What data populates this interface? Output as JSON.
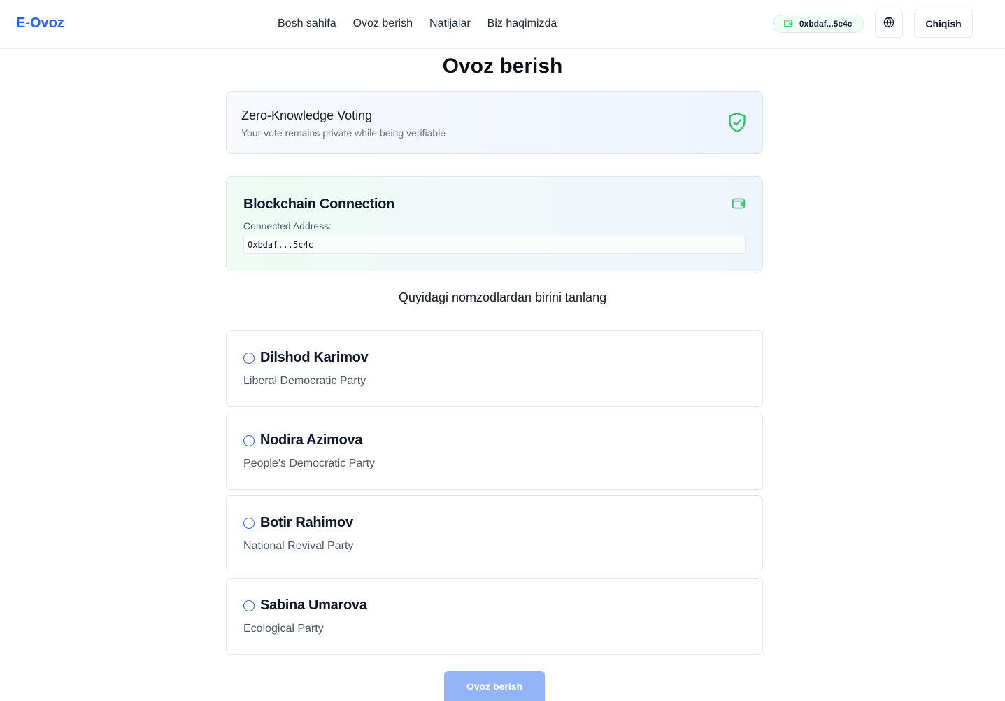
{
  "header": {
    "logo": "E-Ovoz",
    "nav": [
      "Bosh sahifa",
      "Ovoz berish",
      "Natijalar",
      "Biz haqimizda"
    ],
    "wallet_address": "0xbdaf...5c4c",
    "logout_label": "Chiqish"
  },
  "page": {
    "title": "Ovoz berish"
  },
  "zk_card": {
    "title": "Zero-Knowledge Voting",
    "subtitle": "Your vote remains private while being verifiable"
  },
  "blockchain_card": {
    "title": "Blockchain Connection",
    "address_label": "Connected Address:",
    "address": "0xbdaf...5c4c"
  },
  "instruction": "Quyidagi nomzodlardan birini tanlang",
  "candidates": [
    {
      "name": "Dilshod Karimov",
      "party": "Liberal Democratic Party"
    },
    {
      "name": "Nodira Azimova",
      "party": "People's Democratic Party"
    },
    {
      "name": "Botir Rahimov",
      "party": "National Revival Party"
    },
    {
      "name": "Sabina Umarova",
      "party": "Ecological Party"
    }
  ],
  "submit_label": "Ovoz berish",
  "colors": {
    "brand": "#2563eb",
    "accent_green": "#22c55e",
    "submit_disabled": "#93b4f8"
  }
}
